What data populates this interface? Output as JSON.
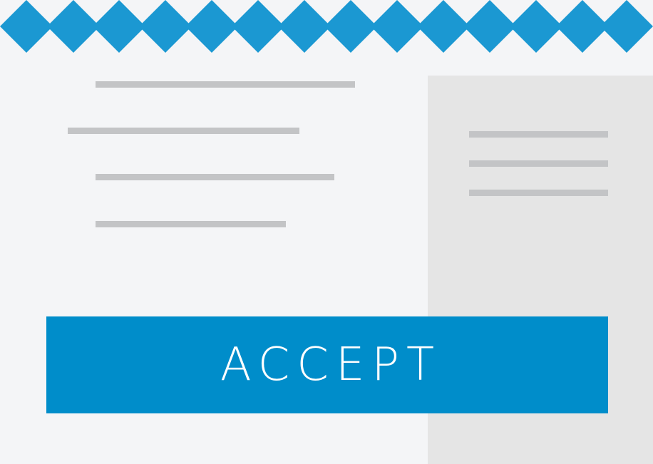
{
  "accent_color": "#1b98d2",
  "button_color": "#008dca",
  "background_color": "#f4f5f7",
  "panel_color": "#e5e5e5",
  "placeholder_line_color": "#c3c4c6",
  "accept_button": {
    "label": "ACCEPT"
  }
}
